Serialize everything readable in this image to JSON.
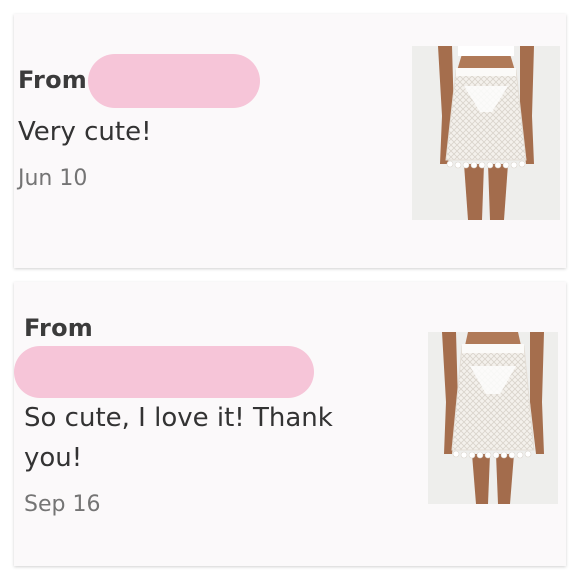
{
  "reviews": [
    {
      "from_label": "From",
      "message": "Very cute!",
      "date": "Jun 10",
      "product_image": "white-crochet-tassel-skirt"
    },
    {
      "from_label": "From",
      "message": "So cute, I love it! Thank you!",
      "date": "Sep 16",
      "product_image": "white-crochet-tassel-skirt"
    }
  ],
  "colors": {
    "redaction": "#f6c5d8",
    "card_background": "#fbf9fa",
    "text_primary": "#333333",
    "text_secondary": "#747474"
  }
}
